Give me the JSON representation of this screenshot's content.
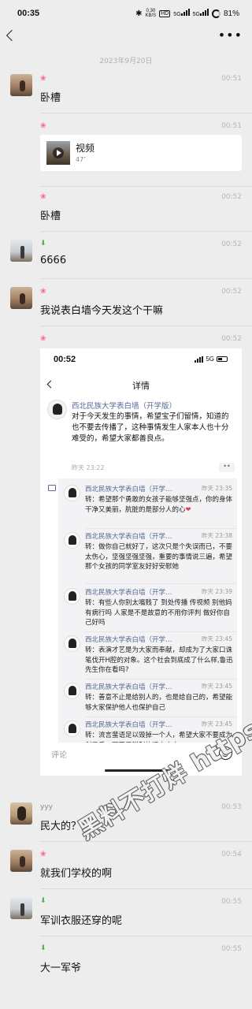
{
  "status_bar": {
    "time": "00:35",
    "network_speed": "0.30",
    "network_unit": "KB/S",
    "hd": "HD",
    "signal_1": "5G",
    "signal_2": "5G",
    "battery": "81%"
  },
  "nav": {
    "more": "•••"
  },
  "date_divider": "2023年9月20日",
  "messages": {
    "m1": {
      "time": "00:51",
      "text": "卧槽"
    },
    "m2": {
      "time": "00:51",
      "video_title": "视频",
      "video_duration": "47″"
    },
    "m3": {
      "time": "00:52",
      "text": "卧槽"
    },
    "m4": {
      "time": "00:52",
      "text": "6666"
    },
    "m5": {
      "time": "00:52",
      "text": "我说表白墙今天发这个干嘛"
    },
    "m6": {
      "time": "00:52"
    },
    "m7": {
      "nickname": "yyy",
      "time": "00:53",
      "text": "民大的？"
    },
    "m8": {
      "time": "00:54",
      "text": "就我们学校的啊"
    },
    "m9": {
      "time": "00:55",
      "text": "军训衣服还穿的呢"
    },
    "m10": {
      "time": "00:55",
      "text": "大一军爷"
    }
  },
  "screenshot": {
    "time": "00:52",
    "network": "5G",
    "title": "详情",
    "post": {
      "author": "西北民族大学表白墙（开学版）",
      "body": "对于今天发生的事情，希望宝子们留情，知道的也不要去传播了，这种事情发生人家本人也十分难受的，希望大家都善良点。",
      "time": "昨天 23:22",
      "more": "••"
    },
    "comments": [
      {
        "name": "西北民族大学表白墙（开学…",
        "time": "昨天 23:35",
        "text": "转：希望那个勇敢的女孩子能够坚强点，你的身体干净又美丽，肮脏的是部分人的心",
        "emoji": "❤"
      },
      {
        "name": "西北民族大学表白墙（开学…",
        "time": "昨天 23:38",
        "text": "转：做你自己就好了，这次只是个失误而已，不要太伤心，坚强坚强坚强，重要的事情说三遍，希望那个女孩的同学室友好好安慰她"
      },
      {
        "name": "西北民族大学表白墙（开学…",
        "time": "昨天 23:39",
        "text": "转：有些人你别太嘴贱了 到处传播 传视频 别他妈有病行吗 人家是不是故意的不用你评判 做好你自己好吗"
      },
      {
        "name": "西北民族大学表白墙（开学…",
        "time": "昨天 23:45",
        "text": "转：表演才艺是为大家而奉献，却成为了大家口诛笔伐开H腔的对象。这个社会到底成了什么样,鲁迅先生你在看吗?"
      },
      {
        "name": "西北民族大学表白墙（开学…",
        "time": "昨天 23:45",
        "text": "转：善意不止是给别人的，也是给自己的，希望能够大家保护他人也保护自己"
      },
      {
        "name": "西北民族大学表白墙（开学…",
        "time": "昨天 23:45",
        "text": "转：流言蜚语足以毁掉一个人，希望大家不要成为刽子手，不要用锐利的语言去击"
      }
    ],
    "comment_placeholder": "评论"
  },
  "watermark": "黑料不打烊 https://bdy6.co"
}
